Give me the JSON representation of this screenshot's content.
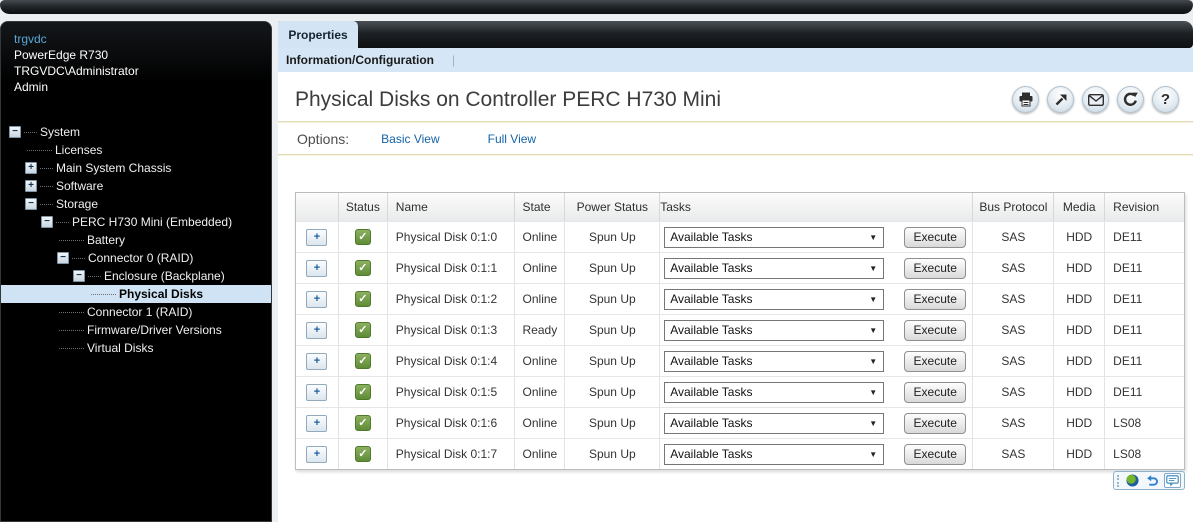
{
  "sidebar": {
    "host": "trgvdc",
    "model": "PowerEdge R730",
    "user": "TRGVDC\\Administrator",
    "role": "Admin",
    "tree": [
      {
        "label": "System",
        "level": 0,
        "toggle": "minus",
        "selected": false
      },
      {
        "label": "Licenses",
        "level": 1,
        "toggle": "none",
        "selected": false
      },
      {
        "label": "Main System Chassis",
        "level": 1,
        "toggle": "plus",
        "selected": false
      },
      {
        "label": "Software",
        "level": 1,
        "toggle": "plus",
        "selected": false
      },
      {
        "label": "Storage",
        "level": 1,
        "toggle": "minus",
        "selected": false
      },
      {
        "label": "PERC H730 Mini (Embedded)",
        "level": 2,
        "toggle": "minus",
        "selected": false
      },
      {
        "label": "Battery",
        "level": 3,
        "toggle": "none",
        "selected": false
      },
      {
        "label": "Connector 0 (RAID)",
        "level": 3,
        "toggle": "minus",
        "selected": false
      },
      {
        "label": "Enclosure (Backplane)",
        "level": 4,
        "toggle": "minus",
        "selected": false
      },
      {
        "label": "Physical Disks",
        "level": 5,
        "toggle": "none",
        "selected": true
      },
      {
        "label": "Connector 1 (RAID)",
        "level": 3,
        "toggle": "none",
        "selected": false
      },
      {
        "label": "Firmware/Driver Versions",
        "level": 3,
        "toggle": "none",
        "selected": false
      },
      {
        "label": "Virtual Disks",
        "level": 3,
        "toggle": "none",
        "selected": false
      }
    ]
  },
  "tabs": {
    "properties": "Properties",
    "subnav": "Information/Configuration",
    "separator": "|"
  },
  "main": {
    "title": "Physical Disks on Controller PERC H730 Mini",
    "toolbar_icons": [
      "print-icon",
      "export-icon",
      "email-icon",
      "refresh-icon",
      "help-icon"
    ],
    "options_label": "Options:",
    "options_links": [
      "Basic View",
      "Full View"
    ],
    "footer_icons": [
      "globe-icon",
      "undo-icon",
      "comment-icon"
    ]
  },
  "table": {
    "headers": [
      "",
      "Status",
      "Name",
      "State",
      "Power Status",
      "Tasks",
      "Bus Protocol",
      "Media",
      "Revision"
    ],
    "task_dropdown_value": "Available Tasks",
    "execute_label": "Execute",
    "rows": [
      {
        "name": "Physical Disk 0:1:0",
        "state": "Online",
        "power": "Spun Up",
        "bus": "SAS",
        "media": "HDD",
        "revision": "DE11"
      },
      {
        "name": "Physical Disk 0:1:1",
        "state": "Online",
        "power": "Spun Up",
        "bus": "SAS",
        "media": "HDD",
        "revision": "DE11"
      },
      {
        "name": "Physical Disk 0:1:2",
        "state": "Online",
        "power": "Spun Up",
        "bus": "SAS",
        "media": "HDD",
        "revision": "DE11"
      },
      {
        "name": "Physical Disk 0:1:3",
        "state": "Ready",
        "power": "Spun Up",
        "bus": "SAS",
        "media": "HDD",
        "revision": "DE11"
      },
      {
        "name": "Physical Disk 0:1:4",
        "state": "Online",
        "power": "Spun Up",
        "bus": "SAS",
        "media": "HDD",
        "revision": "DE11"
      },
      {
        "name": "Physical Disk 0:1:5",
        "state": "Online",
        "power": "Spun Up",
        "bus": "SAS",
        "media": "HDD",
        "revision": "DE11"
      },
      {
        "name": "Physical Disk 0:1:6",
        "state": "Online",
        "power": "Spun Up",
        "bus": "SAS",
        "media": "HDD",
        "revision": "LS08"
      },
      {
        "name": "Physical Disk 0:1:7",
        "state": "Online",
        "power": "Spun Up",
        "bus": "SAS",
        "media": "HDD",
        "revision": "LS08"
      }
    ]
  },
  "icons": {
    "expand_plus": "+",
    "status_ok": "✓",
    "dropdown_arrow": "▼",
    "minus": "−",
    "plus": "+",
    "help_glyph": "?"
  },
  "colors": {
    "accent_link_blue": "#1464a8",
    "tab_blue": "#d3e5f5",
    "selected_tree_bg": "#cfe3f5",
    "status_green": "#5f8c38",
    "divider_tan": "#e3dab4",
    "sidebar_bg": "#000000",
    "dark_bar": "#1d2125"
  }
}
